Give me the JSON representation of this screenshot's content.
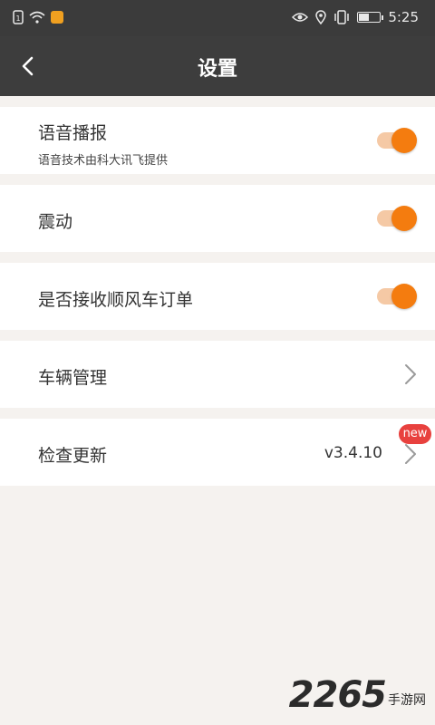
{
  "status_bar": {
    "time": "5:25"
  },
  "app_bar": {
    "title": "设置",
    "back_icon": "chevron-left-icon"
  },
  "settings": {
    "voice": {
      "label": "语音播报",
      "subtitle": "语音技术由科大讯飞提供",
      "enabled": true
    },
    "vibrate": {
      "label": "震动",
      "enabled": true
    },
    "carpool": {
      "label": "是否接收顺风车订单",
      "enabled": true
    },
    "vehicle": {
      "label": "车辆管理",
      "icon": "chevron-right-icon"
    },
    "update": {
      "label": "检查更新",
      "version": "v3.4.10",
      "badge": "new",
      "icon": "chevron-right-icon"
    }
  },
  "colors": {
    "accent": "#f47c0f",
    "toggle_track": "#f5c9a5",
    "badge": "#e8413e",
    "app_bar": "#3d3d3d"
  },
  "watermark": {
    "number": "2265",
    "text": "手游网"
  }
}
